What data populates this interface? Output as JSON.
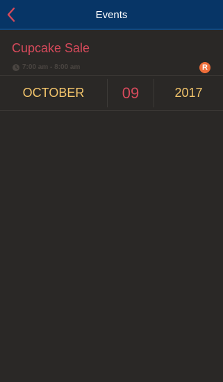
{
  "header": {
    "title": "Events",
    "back_icon": "chevron-left-icon",
    "accent_color": "#d64a5b",
    "bar_color": "#073566"
  },
  "event": {
    "title": "Cupcake Sale",
    "time": "7:00 am - 8:00 am",
    "time_icon": "clock-icon",
    "badge": "R",
    "badge_color": "#ef6e3a",
    "date": {
      "month": "OCTOBER",
      "day": "09",
      "year": "2017"
    }
  }
}
